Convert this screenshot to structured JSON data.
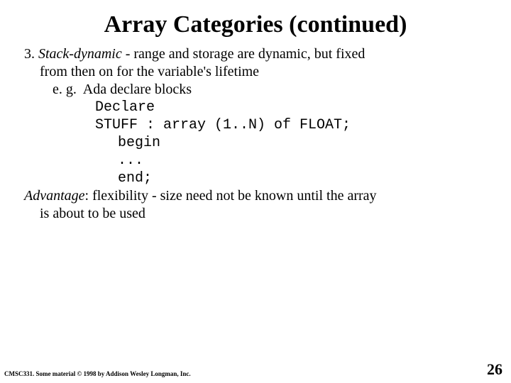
{
  "title": "Array Categories (continued)",
  "body": {
    "line1a": "3. ",
    "line1b": "Stack-dynamic",
    "line1c": " - range and storage are dynamic, but fixed",
    "line2": "from then on for the variable's lifetime",
    "line3": "e. g.  Ada declare blocks",
    "code1": "Declare",
    "code2": "STUFF : array (1..N) of FLOAT;",
    "code3": " begin",
    "code4": " ...",
    "code5": " end;",
    "adv_label": "Advantage",
    "adv_rest": ": flexibility - size need not be known until the array",
    "adv_line2": "is about to be used"
  },
  "footer_left": "CMSC331. Some material © 1998 by Addison Wesley Longman, Inc.",
  "page_number": "26"
}
